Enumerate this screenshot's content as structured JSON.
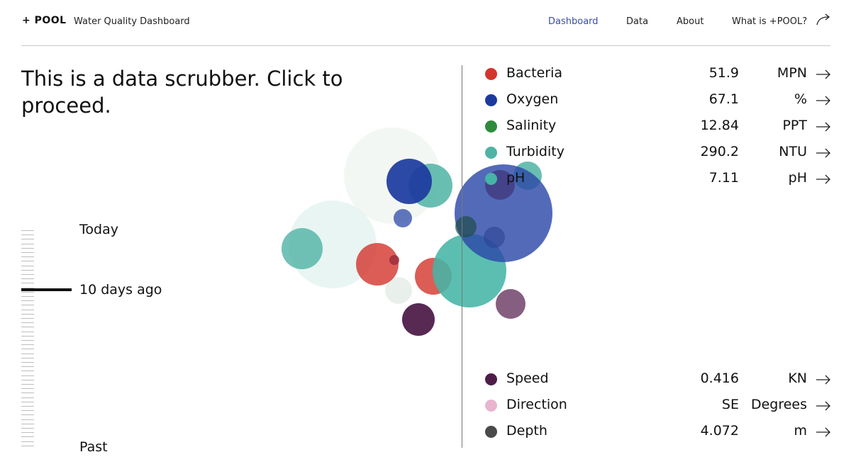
{
  "header": {
    "logo": "+ POOL",
    "title": "Water Quality Dashboard",
    "nav": [
      {
        "label": "Dashboard",
        "active": true
      },
      {
        "label": "Data",
        "active": false
      },
      {
        "label": "About",
        "active": false
      },
      {
        "label": "What is +POOL?",
        "active": false,
        "icon": "external-arrow-icon"
      }
    ]
  },
  "headline": "This is a data scrubber. Click to proceed.",
  "scrubber": {
    "top_label": "Today",
    "current_label": "10 days ago",
    "bottom_label": "Past"
  },
  "metrics": [
    {
      "name": "Bacteria",
      "value": "51.9",
      "unit": "MPN",
      "color": "#d2352c",
      "icon": "arrow-right-icon"
    },
    {
      "name": "Oxygen",
      "value": "67.1",
      "unit": "%",
      "color": "#1c3a9e",
      "icon": "arrow-right-icon"
    },
    {
      "name": "Salinity",
      "value": "12.84",
      "unit": "PPT",
      "color": "#2e8b3e",
      "icon": "arrow-right-icon"
    },
    {
      "name": "Turbidity",
      "value": "290.2",
      "unit": "NTU",
      "color": "#4fb3a5",
      "icon": "arrow-right-icon"
    },
    {
      "name": "pH",
      "value": "7.11",
      "unit": "pH",
      "color": "#44b5a6",
      "icon": "arrow-right-icon"
    }
  ],
  "metrics_bottom": [
    {
      "name": "Speed",
      "value": "0.416",
      "unit": "KN",
      "color": "#4e1d4a",
      "icon": "arrow-right-icon"
    },
    {
      "name": "Direction",
      "value": "SE",
      "unit": "Degrees",
      "color": "#e8b4cf",
      "icon": "arrow-right-icon"
    },
    {
      "name": "Depth",
      "value": "4.072",
      "unit": "m",
      "color": "#4a4a4a",
      "icon": "arrow-right-icon"
    }
  ],
  "colors": {
    "accent_nav": "#3a4fa0",
    "bacteria": "#d2352c",
    "oxygen": "#1c3a9e",
    "salinity": "#2e8b3e",
    "turbidity": "#4fb3a5",
    "speed": "#4e1d4a",
    "depth": "#4a4a4a",
    "direction": "#e8b4cf"
  }
}
